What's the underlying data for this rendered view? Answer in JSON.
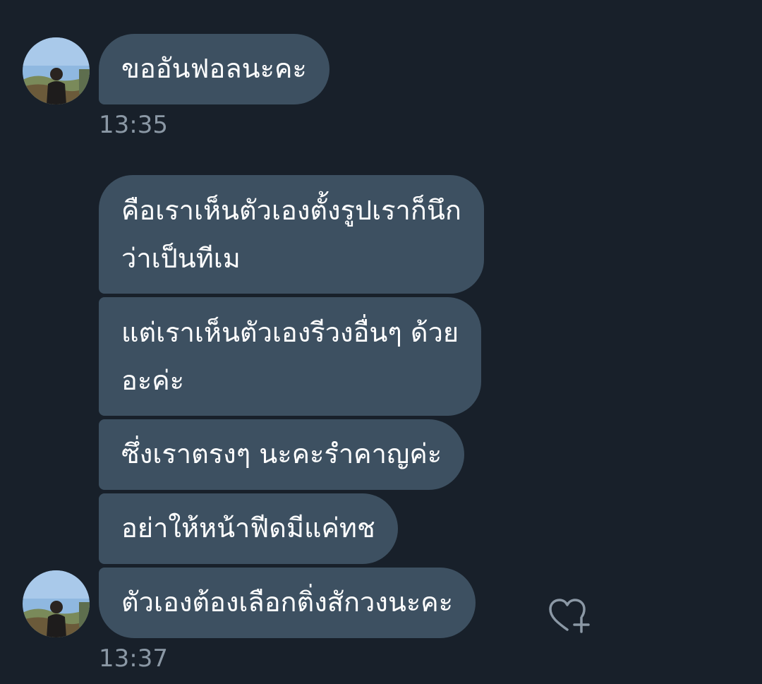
{
  "conversation": {
    "messages": [
      {
        "text": "ขออันฟอลนะคะ",
        "time": "13:35"
      },
      {
        "lines": [
          "คือเราเห็นตัวเองตั้งรูปเราก็นึก",
          "ว่าเป็นทีเม"
        ]
      },
      {
        "lines": [
          "แต่เราเห็นตัวเองรีวงอื่นๆ ด้วย",
          "อะค่ะ"
        ]
      },
      {
        "text": "ซึ่งเราตรงๆ นะคะรำคาญค่ะ"
      },
      {
        "text": "อย่าให้หน้าฟีดมีแค่ทช"
      },
      {
        "text": "ตัวเองต้องเลือกติ่งสักวงนะคะ",
        "time": "13:37"
      }
    ],
    "avatar_icon": "profile-photo",
    "react_icon": "heart-plus-icon"
  },
  "colors": {
    "background": "#18202a",
    "bubble": "#3d5061",
    "text": "#ffffff",
    "timestamp": "#8b98a5"
  }
}
